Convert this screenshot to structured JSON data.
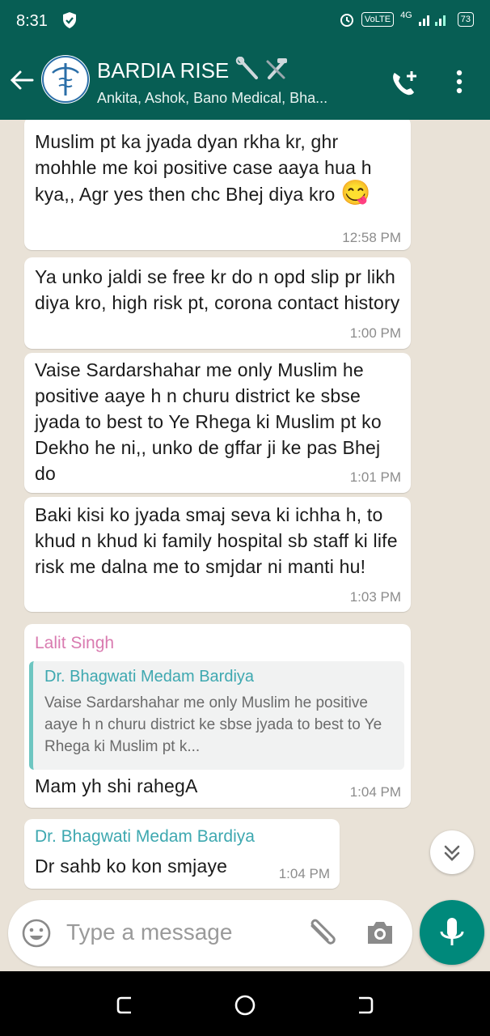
{
  "status": {
    "time": "8:31",
    "network": "4G",
    "volte": "VoLTE",
    "battery": "73"
  },
  "header": {
    "title": "BARDIA RISE",
    "subtitle": "Ankita, Ashok, Bano Medical, Bha..."
  },
  "messages": [
    {
      "text": "Muslim pt ka jyada dyan rkha kr, ghr mohhle me koi positive case aaya hua h kya,, Agr yes then chc Bhej diya kro",
      "emoji": "😋",
      "time": "12:58 PM"
    },
    {
      "text": "Ya unko jaldi se free kr do n opd slip pr likh diya kro, high risk pt, corona contact history",
      "time": "1:00 PM"
    },
    {
      "text": "Vaise Sardarshahar me only Muslim he positive aaye h n churu district ke sbse jyada to best to Ye Rhega ki Muslim pt ko Dekho he ni,, unko  de gffar ji ke pas Bhej do",
      "time": "1:01 PM"
    },
    {
      "text": "Baki kisi ko jyada smaj seva ki ichha h, to khud n khud ki family hospital sb staff ki life risk me dalna me to smjdar ni manti hu!",
      "time": "1:03 PM"
    },
    {
      "sender": "Lalit Singh",
      "quote_sender": "Dr. Bhagwati Medam Bardiya",
      "quote_text": "Vaise Sardarshahar me only Muslim he positive aaye h n churu district ke sbse jyada to best to Ye Rhega ki Muslim pt k...",
      "text": "Mam yh shi rahegA",
      "time": "1:04 PM"
    },
    {
      "sender": "Dr. Bhagwati Medam Bardiya",
      "text": "Dr sahb ko kon smjaye",
      "time": "1:04 PM"
    }
  ],
  "input": {
    "placeholder": "Type a message"
  },
  "colors": {
    "header": "#075e54",
    "accent": "#00897b",
    "sender_pink": "#d97bb0",
    "sender_teal": "#3ea8b0"
  },
  "icons": [
    "back-arrow-icon",
    "group-avatar-icon",
    "add-call-icon",
    "more-vert-icon",
    "emoji-icon",
    "attach-icon",
    "camera-icon",
    "mic-icon",
    "scroll-down-icon"
  ]
}
